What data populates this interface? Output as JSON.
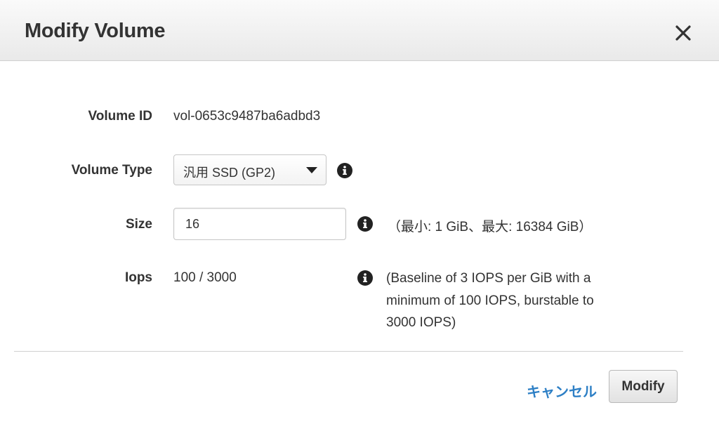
{
  "dialog": {
    "title": "Modify Volume"
  },
  "fields": {
    "volume_id": {
      "label": "Volume ID",
      "value": "vol-0653c9487ba6adbd3"
    },
    "volume_type": {
      "label": "Volume Type",
      "selected": "汎用 SSD (GP2)"
    },
    "size": {
      "label": "Size",
      "value": "16",
      "hint": "（最小: 1 GiB、最大: 16384 GiB）"
    },
    "iops": {
      "label": "Iops",
      "value": "100 / 3000",
      "hint": "(Baseline of 3 IOPS per GiB with a minimum of 100 IOPS, burstable to 3000 IOPS)"
    }
  },
  "footer": {
    "cancel_label": "キャンセル",
    "modify_label": "Modify"
  },
  "icons": {
    "close": "close-icon",
    "info": "info-icon",
    "dropdown": "chevron-down-icon"
  },
  "colors": {
    "link": "#2d7fc5",
    "text": "#333333",
    "info_icon": "#222222"
  }
}
